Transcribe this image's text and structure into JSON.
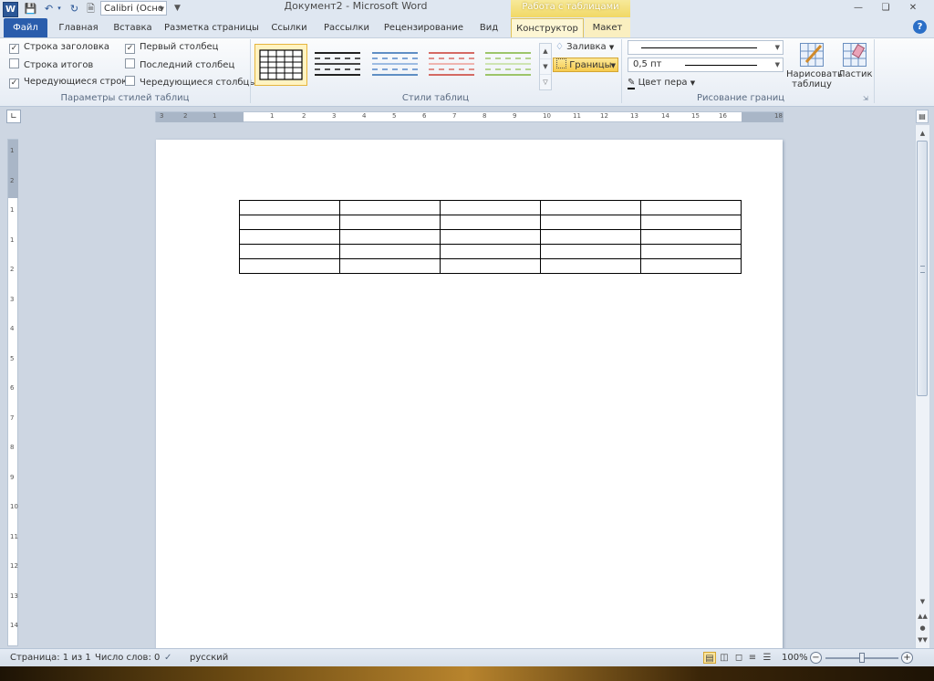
{
  "titlebar": {
    "app_icon": "W",
    "font_name": "Calibri (Осно",
    "doc_title": "Документ2 - Microsoft Word",
    "context_tab_header": "Работа с таблицами"
  },
  "tabs": {
    "file": "Файл",
    "home": "Главная",
    "insert": "Вставка",
    "page_layout": "Разметка страницы",
    "references": "Ссылки",
    "mailings": "Рассылки",
    "review": "Рецензирование",
    "view": "Вид",
    "design": "Конструктор",
    "layout": "Макет",
    "help": "?"
  },
  "ribbon": {
    "style_options": {
      "header_row": "Строка заголовка",
      "total_row": "Строка итогов",
      "banded_rows": "Чередующиеся строки",
      "first_column": "Первый столбец",
      "last_column": "Последний столбец",
      "banded_columns": "Чередующиеся столбцы",
      "group_label": "Параметры стилей таблиц",
      "checked": {
        "header_row": true,
        "total_row": false,
        "banded_rows": true,
        "first_column": true,
        "last_column": false,
        "banded_columns": false
      }
    },
    "table_styles": {
      "group_label": "Стили таблиц",
      "shading": "Заливка",
      "borders": "Границы"
    },
    "draw_borders": {
      "pen_weight": "0,5 пт",
      "pen_color": "Цвет пера",
      "draw_table": "Нарисовать таблицу",
      "draw_table_line1": "Нарисовать",
      "draw_table_line2": "таблицу",
      "eraser": "Ластик",
      "group_label": "Рисование границ"
    }
  },
  "ruler": {
    "h_numbers": [
      "3",
      "2",
      "1",
      "1",
      "2",
      "3",
      "4",
      "5",
      "6",
      "7",
      "8",
      "9",
      "10",
      "11",
      "12",
      "13",
      "14",
      "15",
      "16",
      "18"
    ],
    "v_numbers": [
      "1",
      "2",
      "1",
      "1",
      "2",
      "3",
      "4",
      "5",
      "6",
      "7",
      "8",
      "9",
      "10",
      "11",
      "12",
      "13",
      "14"
    ]
  },
  "document": {
    "table": {
      "rows": 5,
      "cols": 5
    }
  },
  "statusbar": {
    "page": "Страница: 1 из 1",
    "words": "Число слов: 0",
    "language": "русский",
    "zoom": "100%",
    "zoom_level": 1.0
  },
  "colors": {
    "file_tab": "#2a5dac",
    "context_tab": "#f1d865",
    "ribbon_bg": "#e6ecf4"
  }
}
